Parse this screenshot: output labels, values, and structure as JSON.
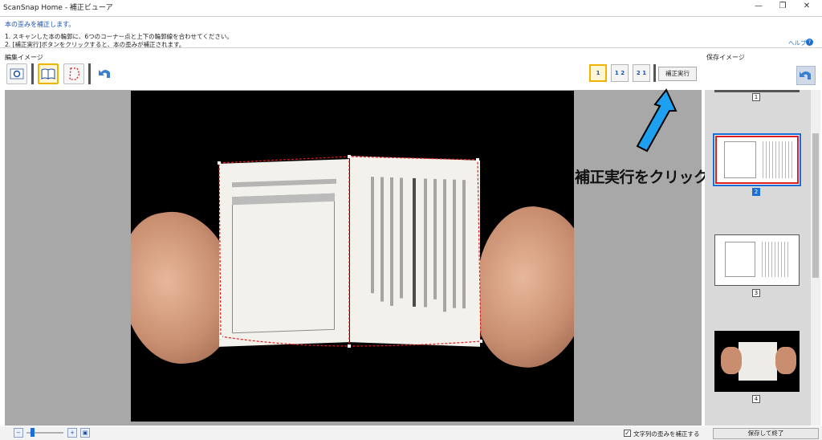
{
  "window": {
    "title": "ScanSnap Home - 補正ビューア",
    "controls": [
      "minimize-icon",
      "restore-icon",
      "close-icon"
    ]
  },
  "instructions": {
    "heading": "本の歪みを補正します。",
    "line1": "1. スキャンした本の輪郭に、6つのコーナー点と上下の輪郭線を合わせてください。",
    "line2": "2. [補正実行]ボタンをクリックすると、本の歪みが補正されます。",
    "help": "ヘルプ"
  },
  "edit_panel": {
    "label": "編集イメージ",
    "exec_button": "補正実行",
    "page_buttons": [
      "1",
      "1 2",
      "2 1"
    ]
  },
  "save_panel": {
    "label": "保存イメージ",
    "thumbnails": [
      {
        "number": "1",
        "selected": false
      },
      {
        "number": "2",
        "selected": true
      },
      {
        "number": "3",
        "selected": false
      },
      {
        "number": "4",
        "selected": false
      }
    ]
  },
  "annotation": {
    "text": "補正実行をクリック",
    "arrow_color": "#1ea0f0"
  },
  "bottom": {
    "checkbox_label": "文字列の歪みを補正する",
    "checkbox_checked": true,
    "save_button": "保存して終了"
  },
  "colors": {
    "accent": "#1a6ed8",
    "active_outline": "#f0b400",
    "contour_line": "#e02020"
  }
}
